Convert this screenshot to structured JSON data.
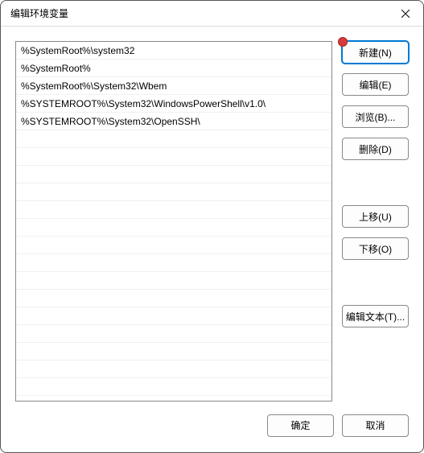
{
  "title": "编辑环境变量",
  "list_items": [
    "%SystemRoot%\\system32",
    "%SystemRoot%",
    "%SystemRoot%\\System32\\Wbem",
    "%SYSTEMROOT%\\System32\\WindowsPowerShell\\v1.0\\",
    "%SYSTEMROOT%\\System32\\OpenSSH\\"
  ],
  "buttons": {
    "new": "新建(N)",
    "edit": "编辑(E)",
    "browse": "浏览(B)...",
    "delete": "删除(D)",
    "move_up": "上移(U)",
    "move_down": "下移(O)",
    "edit_text": "编辑文本(T)..."
  },
  "footer": {
    "ok": "确定",
    "cancel": "取消"
  }
}
